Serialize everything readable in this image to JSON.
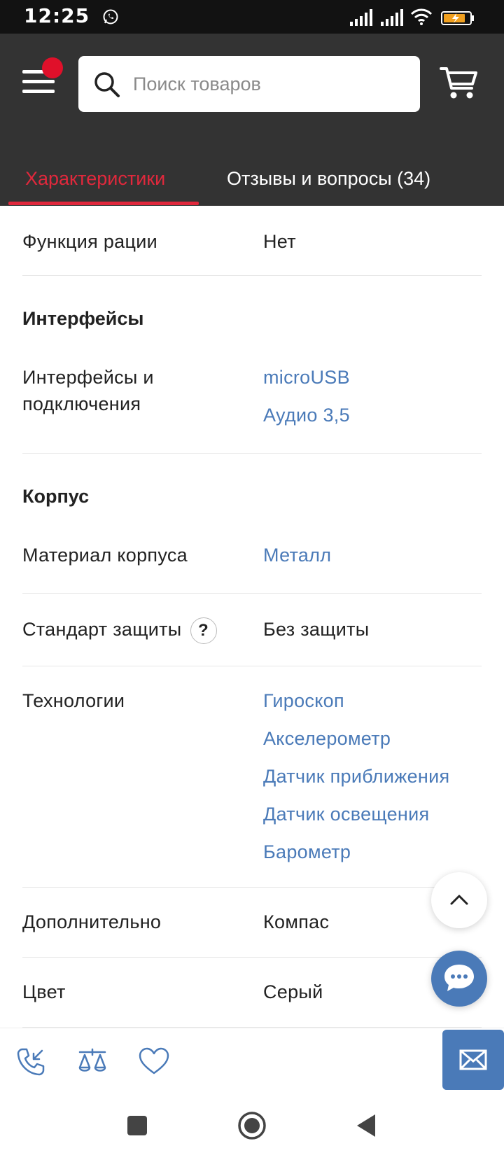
{
  "status_bar": {
    "time": "12:25"
  },
  "header": {
    "search_placeholder": "Поиск товаров"
  },
  "tabs": [
    {
      "label": "Характеристики",
      "active": true
    },
    {
      "label": "Отзывы и вопросы (34)",
      "active": false
    }
  ],
  "specs": {
    "walkie_talkie": {
      "label": "Функция рации",
      "value": "Нет"
    },
    "interfaces_section": "Интерфейсы",
    "interfaces": {
      "label_line1": "Интерфейсы и",
      "label_line2": "подключения",
      "values": [
        "microUSB",
        "Аудио 3,5"
      ]
    },
    "body_section": "Корпус",
    "body_material": {
      "label": "Материал корпуса",
      "value": "Металл"
    },
    "protection": {
      "label": "Стандарт защиты",
      "help": "?",
      "value": "Без защиты"
    },
    "technologies": {
      "label": "Технологии",
      "values": [
        "Гироскоп",
        "Акселерометр",
        "Датчик приближения",
        "Датчик освещения",
        "Барометр"
      ]
    },
    "additional": {
      "label": "Дополнительно",
      "value": "Компас"
    },
    "color": {
      "label": "Цвет",
      "value": "Серый"
    }
  },
  "colors": {
    "header_bg": "#333333",
    "accent_red": "#e0283c",
    "link_blue": "#4a7ab8"
  },
  "icons": [
    "whatsapp-icon",
    "signal-icon",
    "wifi-icon",
    "battery-icon",
    "menu-icon",
    "search-icon",
    "cart-icon",
    "chevron-up-icon",
    "chat-icon",
    "phone-icon",
    "compare-icon",
    "heart-icon",
    "mail-icon",
    "square-nav-icon",
    "circle-nav-icon",
    "back-nav-icon"
  ]
}
